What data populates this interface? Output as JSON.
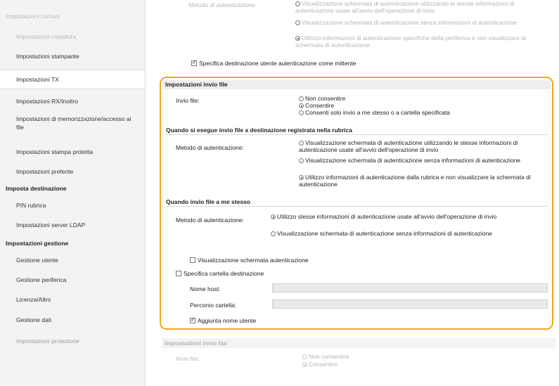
{
  "sidebar": {
    "items": [
      {
        "label": "Impostazioni comuni"
      },
      {
        "label": "Impostazioni copiatura"
      },
      {
        "label": "Impostazioni stampante"
      },
      {
        "label": "Impostazioni TX"
      },
      {
        "label": "Impostazioni RX/Inoltro"
      },
      {
        "label": "Impostazioni di memorizzazione/accesso ai file"
      },
      {
        "label": "Impostazioni stampa protetta"
      },
      {
        "label": "Impostazioni preferite"
      },
      {
        "label": "Imposta destinazione"
      },
      {
        "label": "PIN rubrica"
      },
      {
        "label": "Impostazioni server LDAP"
      },
      {
        "label": "Impostazioni gestione"
      },
      {
        "label": "Gestione utente"
      },
      {
        "label": "Gestione periferica"
      },
      {
        "label": "Licenza/Altro"
      },
      {
        "label": "Gestione dati"
      },
      {
        "label": "Impostazioni protezione"
      }
    ]
  },
  "top_faded": {
    "label": "Metodo di autenticazione:",
    "opt1": "Visualizzazione schermata di autenticazione utilizzando le stesse informazioni di autenticazione usate all'avvio dell'operazione di invio",
    "opt2": "Visualizzazione schermata di autenticazione senza informazioni di autenticazione",
    "opt3": "Utilizzo informazioni di autenticazione specifiche della periferica e non visualizzare la schermata di autenticazione",
    "check_label": "Specifica destinazione utente autenticazione come mittente"
  },
  "invio_file": {
    "title": "Impostazioni invio file",
    "label": "Invio file:",
    "options": [
      "Non consentire",
      "Consentire",
      "Consenti solo invio a me stesso o a cartella specificata"
    ],
    "rubrica": {
      "title": "Quando si esegue invio file a destinazione registrata nella rubrica",
      "label": "Metodo di autenticazione:",
      "options": [
        "Visualizzazione schermata di autenticazione utilizzando le stesse informazioni di autenticazione usate all'avvio dell'operazione di invio",
        "Visualizzazione schermata di autenticazione senza informazioni di autenticazione",
        "Utilizzo informazioni di autenticazione dalla rubrica e non visualizzare la schermata di autenticazione"
      ]
    },
    "me_stesso": {
      "title": "Quando invio file a me stesso",
      "label": "Metodo di autenticazione:",
      "options": [
        "Utilizzo stesse informazioni di autenticazione usate all'avvio dell'operazione di invio",
        "Visualizzazione schermata di autenticazione senza informazioni di autenticazione"
      ],
      "check_label": "Visualizzazione schermata autenticazione"
    },
    "cartella": {
      "check_label": "Specifica cartella destinazione",
      "host_label": "Nome host:",
      "host_value": "",
      "path_label": "Percorso cartella:",
      "path_value": "",
      "add_user_label": "Aggiunta nome utente"
    }
  },
  "invio_fax": {
    "title": "Impostazioni invio fax",
    "label": "Invio fax:",
    "options": [
      "Non consentire",
      "Consentire"
    ]
  },
  "colors": {
    "highlight": "#f3a81c"
  }
}
